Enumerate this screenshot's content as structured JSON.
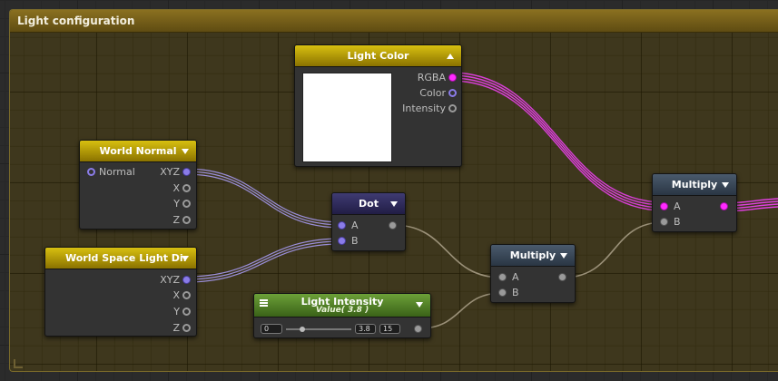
{
  "group": {
    "title": "Light configuration"
  },
  "nodes": {
    "light_color": {
      "title": "Light Color",
      "swatch_color": "#ffffff",
      "outputs": [
        "RGBA",
        "Color",
        "Intensity"
      ]
    },
    "world_normal": {
      "title": "World Normal",
      "input": "Normal",
      "outputs": [
        "XYZ",
        "X",
        "Y",
        "Z"
      ]
    },
    "world_space_light_dir": {
      "title": "World Space Light Dir",
      "outputs": [
        "XYZ",
        "X",
        "Y",
        "Z"
      ]
    },
    "dot": {
      "title": "Dot",
      "inputs": [
        "A",
        "B"
      ]
    },
    "multiply_1": {
      "title": "Multiply",
      "inputs": [
        "A",
        "B"
      ]
    },
    "multiply_2": {
      "title": "Multiply",
      "inputs": [
        "A",
        "B"
      ]
    },
    "light_intensity": {
      "title": "Light Intensity",
      "subtitle": "Value( 3.8 )",
      "min": "0",
      "value": "3.8",
      "max": "15",
      "slider_fraction": 0.253
    }
  },
  "colors": {
    "color_wire": "#e040e0",
    "vector_wire": "#9a8ed8",
    "float_wire": "#9a9078",
    "group_header": "#8a7020"
  }
}
